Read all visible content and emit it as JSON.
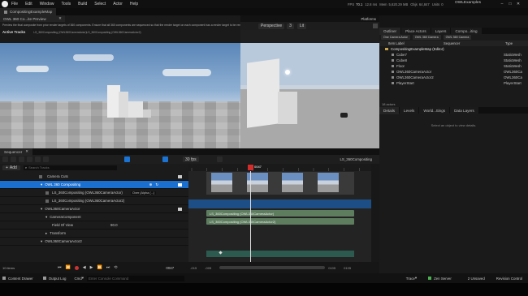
{
  "menu": {
    "items": [
      "File",
      "Edit",
      "Window",
      "Tools",
      "Build",
      "Select",
      "Actor",
      "Help"
    ],
    "project": "OWLExamples",
    "stats": {
      "fps": "70.1",
      "ms": "12.8 ms",
      "mem": "5,620.29 MB",
      "objs": "64,847",
      "units": "0"
    }
  },
  "tabs": {
    "map_tab": "CompositingExampleMap",
    "composure_tab": "OWL 360 Co...ite Preview",
    "outliner": "Outliner",
    "place_actors": "Place Actors",
    "layers": "Layers",
    "compositing": "Compo...iting"
  },
  "preview": {
    "description": "Preview the final composite from prior render targets of 360 components. Ensure that all 360 components are sequenced so that the render target on each component has a render target to be rendered.",
    "active_tracks_label": "Active Tracks",
    "active_tracks_value": "LS_360Compositing (OWL360CameraActor)LS_360Compositing (OWL360CameraActor2)"
  },
  "viewport": {
    "perspective": "Perspective",
    "lit": "Lit",
    "platforms": "Platforms",
    "num": "3"
  },
  "outliner": {
    "filters": [
      "One Camera Actor",
      "OWL 360 Camera",
      "OWL 360 Camera"
    ],
    "col_label": "Item Label",
    "col_seq": "Sequencer",
    "col_type": "Type",
    "items": [
      {
        "label": "CompositingExampleMap (Editor)",
        "type": ""
      },
      {
        "label": "Cube7",
        "type": "StaticMesh"
      },
      {
        "label": "Cube8",
        "type": "StaticMesh"
      },
      {
        "label": "Floor",
        "type": "StaticMesh"
      },
      {
        "label": "OWL360CameraActor",
        "type": "OWL360Ca"
      },
      {
        "label": "OWL360CameraActor2",
        "type": "OWL360Ca"
      },
      {
        "label": "PlayerStart",
        "type": "PlayerStart"
      }
    ],
    "count": "18 actors"
  },
  "details": {
    "tabs": [
      "Details",
      "Levels",
      "World...ttings",
      "Data Layers"
    ],
    "empty": "Select an object to view details."
  },
  "sequencer": {
    "tab": "Sequencer",
    "seq_name": "LS_360Compositing",
    "fps": "30 fps",
    "add": "Add",
    "search_placeholder": "Search Tracks",
    "current_frame": "0047",
    "frame_out": "0047",
    "rows": [
      {
        "label": "Camera Cuts",
        "indent": 0
      },
      {
        "label": "OWL 360 Compositing",
        "indent": 0,
        "selected": true
      },
      {
        "label": "LS_360Compositing (OWL360CameraActor)",
        "indent": 1,
        "extra": "Over (Alpha (...)"
      },
      {
        "label": "LS_360Compositing (OWL360CameraActor2)",
        "indent": 1
      },
      {
        "label": "OWL360CameraActor",
        "indent": 0
      },
      {
        "label": "CameraComponent",
        "indent": 1
      },
      {
        "label": "Field Of View",
        "indent": 2,
        "value": "90.0"
      },
      {
        "label": "Transform",
        "indent": 1
      },
      {
        "label": "OWL360CameraActor2",
        "indent": 0
      }
    ],
    "items_count": "10 items",
    "tick_labels": [
      "-015",
      "-005",
      "0005",
      "0015",
      "0025",
      "0035",
      "0045",
      "0055",
      "0065",
      "0075",
      "0085",
      "0095"
    ],
    "bottom_left": "-015",
    "bottom_mid": "-005",
    "bottom_r1": "0105",
    "bottom_r2": "0105",
    "tracks": [
      "LS_360Compositing (OWL360CameraActor)",
      "LS_360Compositing (OWL360CameraActor2)"
    ]
  },
  "statusbar": {
    "content_drawer": "Content Drawer",
    "output_log": "Output Log",
    "cmd": "Cmd",
    "console_placeholder": "Enter Console Command",
    "trace": "Trace",
    "zen": "Zen Server",
    "unsaved": "2 Unsaved",
    "revision": "Revision Control"
  }
}
